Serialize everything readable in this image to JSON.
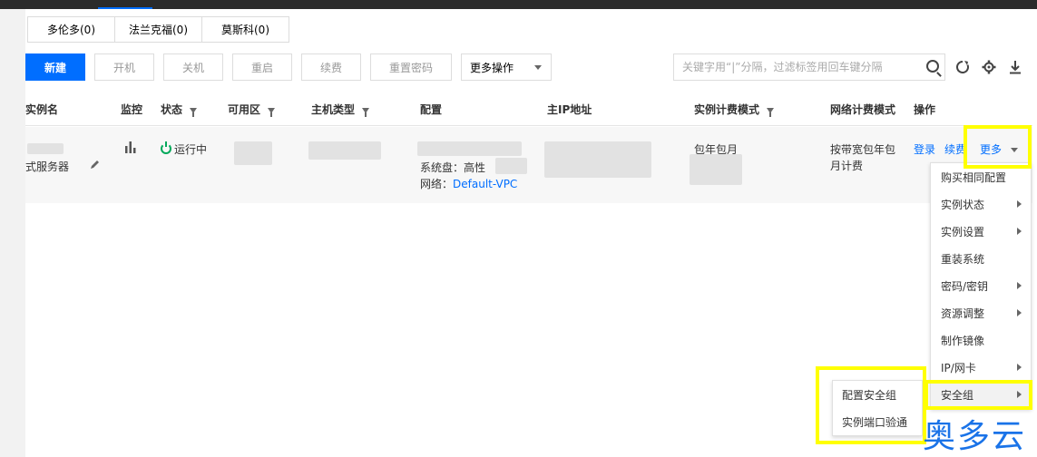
{
  "regions": [
    "多伦多(0)",
    "法兰克福(0)",
    "莫斯科(0)"
  ],
  "toolbar": {
    "new": "新建",
    "start": "开机",
    "stop": "关机",
    "restart": "重启",
    "renew": "续费",
    "reset_password": "重置密码",
    "more_actions": "更多操作",
    "search_placeholder": "关键字用“|”分隔，过滤标签用回车键分隔"
  },
  "icons": {
    "refresh": "refresh-icon",
    "settings": "gear-icon",
    "download": "download-icon",
    "search": "search-icon"
  },
  "columns": {
    "name": "实例名",
    "monitor": "监控",
    "status": "状态",
    "zone": "可用区",
    "type": "主机类型",
    "config": "配置",
    "ip": "主IP地址",
    "billing": "实例计费模式",
    "network_billing": "网络计费模式",
    "actions": "操作"
  },
  "row": {
    "name_suffix": "式服务器",
    "status": "运行中",
    "config_disk": "系统盘：高性",
    "config_network_label": "网络：",
    "config_network_value": "Default-VPC",
    "billing": "包年包月",
    "network_billing_line1": "按带宽包年包",
    "network_billing_line2": "月计费",
    "action_login": "登录",
    "action_renew": "续费",
    "action_more": "更多"
  },
  "more_menu": [
    "购买相同配置",
    "实例状态",
    "实例设置",
    "重装系统",
    "密码/密钥",
    "资源调整",
    "制作镜像",
    "IP/网卡",
    "安全组"
  ],
  "more_menu_has_submenu": [
    false,
    true,
    true,
    false,
    true,
    true,
    false,
    true,
    true
  ],
  "security_submenu": [
    "配置安全组",
    "实例端口验通"
  ],
  "watermark": "奥多云",
  "colors": {
    "primary": "#006eff",
    "highlight": "#ffff00",
    "running": "#00a85a"
  }
}
